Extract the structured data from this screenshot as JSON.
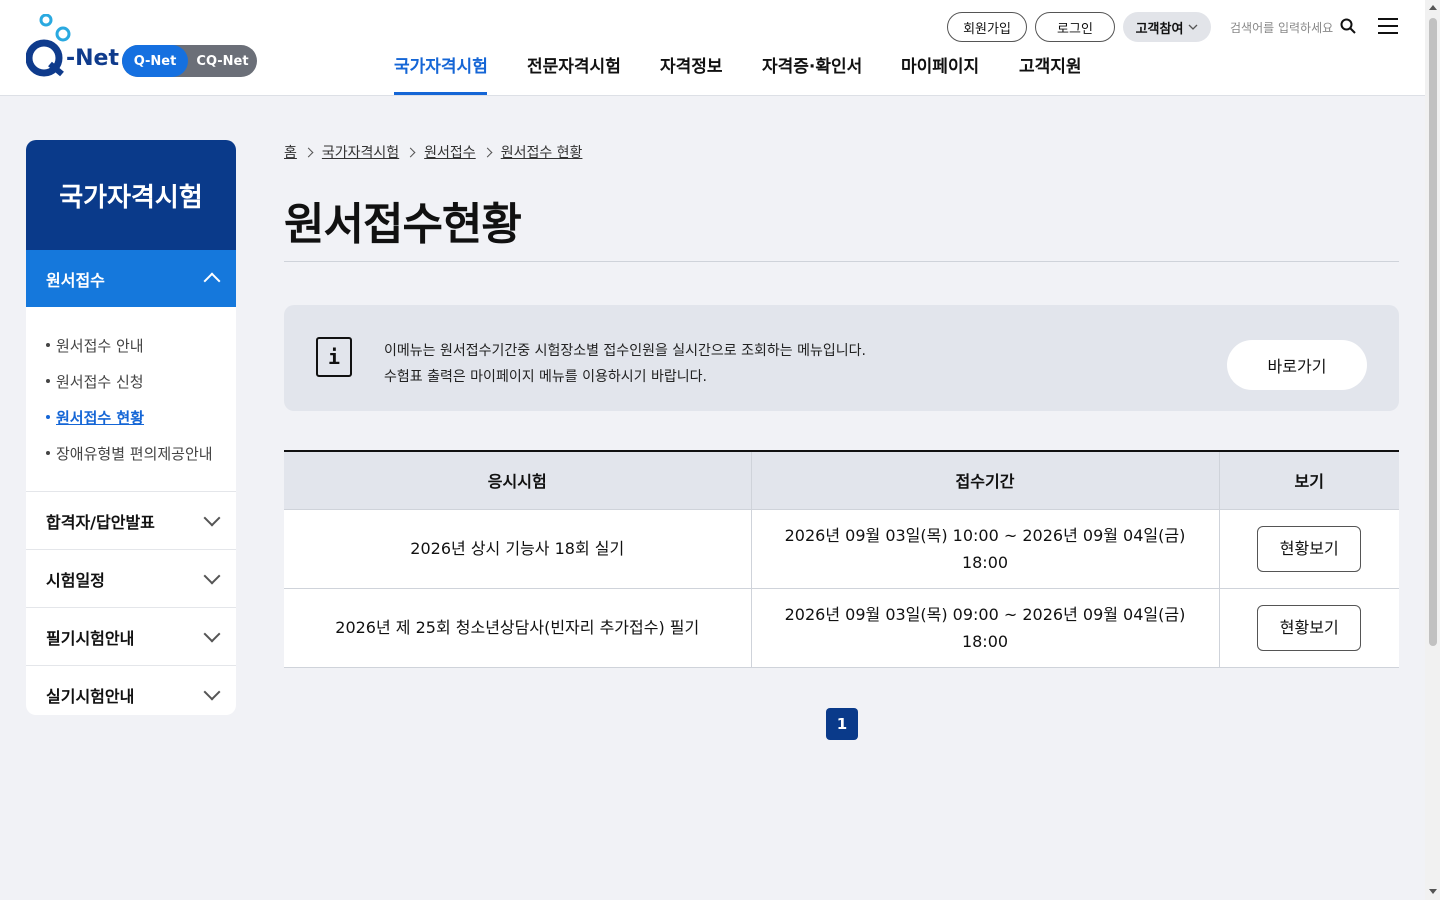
{
  "header": {
    "logo_text": "-Net",
    "net_toggle": [
      "Q-Net",
      "CQ-Net"
    ],
    "util_buttons": {
      "signup": "회원가입",
      "login": "로그인",
      "participate": "고객참여"
    },
    "search_placeholder": "검색어를 입력하세요",
    "gnb": [
      "국가자격시험",
      "전문자격시험",
      "자격정보",
      "자격증·확인서",
      "마이페이지",
      "고객지원"
    ],
    "active_gnb": "국가자격시험",
    "accent_color": "#1566d6"
  },
  "sidebar": {
    "title": "국가자격시험",
    "open_menu": "원서접수",
    "sub_items": [
      "원서접수 안내",
      "원서접수 신청",
      "원서접수 현황",
      "장애유형별 편의제공안내"
    ],
    "active_sub": "원서접수 현황",
    "menus": [
      "합격자/답안발표",
      "시험일정",
      "필기시험안내",
      "실기시험안내"
    ],
    "title_color": "#0a3a8a",
    "open_color": "#1578dc"
  },
  "breadcrumb": [
    "홈",
    "국가자격시험",
    "원서접수",
    "원서접수 현황"
  ],
  "page_title": "원서접수현황",
  "notice": {
    "lines": [
      "이메뉴는 원서접수기간중 시험장소별 접수인원을 실시간으로 조회하는 메뉴입니다.",
      "수험표 출력은 마이페이지 메뉴를 이용하시기 바랍니다."
    ],
    "button": "바로가기"
  },
  "table": {
    "headers": [
      "응시시험",
      "접수기간",
      "보기"
    ],
    "rows": [
      {
        "exam": "2026년 상시 기능사 18회 실기",
        "period_1": "2026년 09월 03일(목) 10:00 ~ 2026년 09월 04일(금)",
        "period_2": "18:00",
        "action": "현황보기"
      },
      {
        "exam": "2026년 제 25회 청소년상담사(빈자리 추가접수) 필기",
        "period_1": "2026년 09월 03일(목) 09:00 ~ 2026년 09월 04일(금)",
        "period_2": "18:00",
        "action": "현황보기"
      }
    ]
  },
  "pagination": {
    "current": "1"
  }
}
